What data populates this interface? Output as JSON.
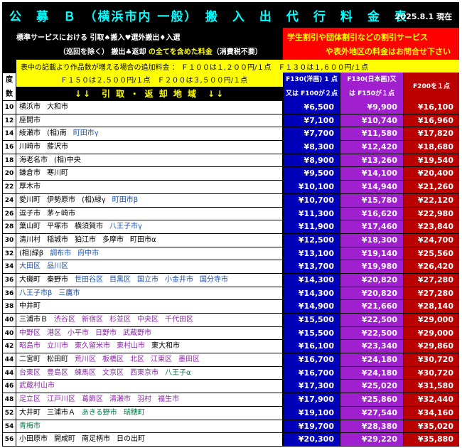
{
  "header": {
    "title": "公　募　Ｂ　（横浜市内 一般）　搬　入　出　代　行　料　金　表",
    "date": "2025.8.1 現在"
  },
  "service_left": {
    "line1_a": "標準サービスにおける ",
    "line1_b": "引取♠搬入♥選外搬出♦入選",
    "line2_a": "（巡回を除く） ",
    "line2_b": "搬出♣返却",
    "line2_c": " の全てを含めた料金",
    "line2_d": "（消費税不要）"
  },
  "service_right": {
    "line1": "学生割引や団体割引などの割引サービス",
    "line2": "や表外地区の料金はお問合せ下さい"
  },
  "note": {
    "line1": "表中の記載より作品数が増える場合の追加料金 ： Ｆ１００は１,２００円/１点　Ｆ１３０は１,６００円/１点",
    "line2": "Ｆ１５０は２,５００円/１点　Ｆ２００は３,５００円/１点"
  },
  "table_header": {
    "do_top": "度",
    "do_bottom": "数",
    "area": "↓↓　引 取 ・ 返 却 地 域　↓↓",
    "col1_top": "F130(洋画) 1 点",
    "col1_bottom": "又は F100が２点",
    "col2_top": "F130(日本画)又",
    "col2_bottom": "は F150が１点",
    "col3": "F200を１点"
  },
  "rows": [
    {
      "code": "10",
      "areas": [
        {
          "t": "横浜市",
          "c": "k"
        },
        {
          "t": "大和市",
          "c": "k"
        }
      ],
      "p1": "¥6,500",
      "p2": "¥9,900",
      "p3": "¥16,100"
    },
    {
      "code": "12",
      "areas": [
        {
          "t": "座間市",
          "c": "k"
        }
      ],
      "p1": "¥7,100",
      "p2": "¥10,740",
      "p3": "¥16,960"
    },
    {
      "code": "14",
      "areas": [
        {
          "t": "綾瀬市",
          "c": "k"
        },
        {
          "t": "(相)南",
          "c": "k"
        },
        {
          "t": "町田市γ",
          "c": "h"
        }
      ],
      "p1": "¥7,700",
      "p2": "¥11,580",
      "p3": "¥17,820"
    },
    {
      "code": "16",
      "areas": [
        {
          "t": "川崎市",
          "c": "k"
        },
        {
          "t": "藤沢市",
          "c": "k"
        }
      ],
      "p1": "¥8,300",
      "p2": "¥12,420",
      "p3": "¥18,680"
    },
    {
      "code": "18",
      "areas": [
        {
          "t": "海老名市",
          "c": "k"
        },
        {
          "t": "(相)中央",
          "c": "k"
        }
      ],
      "p1": "¥8,900",
      "p2": "¥13,260",
      "p3": "¥19,540"
    },
    {
      "code": "20",
      "areas": [
        {
          "t": "鎌倉市",
          "c": "k"
        },
        {
          "t": "寒川町",
          "c": "k"
        }
      ],
      "p1": "¥9,500",
      "p2": "¥14,100",
      "p3": "¥20,400"
    },
    {
      "code": "22",
      "areas": [
        {
          "t": "厚木市",
          "c": "k"
        }
      ],
      "p1": "¥10,100",
      "p2": "¥14,940",
      "p3": "¥21,260"
    },
    {
      "code": "24",
      "areas": [
        {
          "t": "愛川町",
          "c": "k"
        },
        {
          "t": "伊勢原市",
          "c": "k"
        },
        {
          "t": "(相)緑γ",
          "c": "k"
        },
        {
          "t": "町田市β",
          "c": "h"
        }
      ],
      "p1": "¥10,700",
      "p2": "¥15,780",
      "p3": "¥22,120"
    },
    {
      "code": "26",
      "areas": [
        {
          "t": "逗子市",
          "c": "k"
        },
        {
          "t": "茅ヶ崎市",
          "c": "k"
        }
      ],
      "p1": "¥11,300",
      "p2": "¥16,620",
      "p3": "¥22,980"
    },
    {
      "code": "28",
      "areas": [
        {
          "t": "葉山町",
          "c": "k"
        },
        {
          "t": "平塚市",
          "c": "k"
        },
        {
          "t": "横須賀市",
          "c": "k"
        },
        {
          "t": "八王子市γ",
          "c": "h"
        }
      ],
      "p1": "¥11,900",
      "p2": "¥17,460",
      "p3": "¥23,840"
    },
    {
      "code": "30",
      "areas": [
        {
          "t": "清川村",
          "c": "k"
        },
        {
          "t": "稲城市",
          "c": "k"
        },
        {
          "t": "狛江市",
          "c": "k"
        },
        {
          "t": "多摩市",
          "c": "k"
        },
        {
          "t": "町田市α",
          "c": "k"
        }
      ],
      "p1": "¥12,500",
      "p2": "¥18,300",
      "p3": "¥24,700"
    },
    {
      "code": "32",
      "areas": [
        {
          "t": "(相)緑β",
          "c": "k"
        },
        {
          "t": "調布市",
          "c": "h"
        },
        {
          "t": "府中市",
          "c": "h"
        }
      ],
      "p1": "¥13,100",
      "p2": "¥19,140",
      "p3": "¥25,560"
    },
    {
      "code": "34",
      "areas": [
        {
          "t": "大田区",
          "c": "h"
        },
        {
          "t": "品川区",
          "c": "h"
        }
      ],
      "p1": "¥13,700",
      "p2": "¥19,980",
      "p3": "¥26,420"
    },
    {
      "code": "36",
      "areas": [
        {
          "t": "大磯町",
          "c": "k"
        },
        {
          "t": "秦野市",
          "c": "k"
        },
        {
          "t": "世田谷区",
          "c": "h"
        },
        {
          "t": "目黒区",
          "c": "h"
        },
        {
          "t": "国立市",
          "c": "h"
        },
        {
          "t": "小金井市",
          "c": "h"
        },
        {
          "t": "国分寺市",
          "c": "h"
        }
      ],
      "p1": "¥14,300",
      "p2": "¥20,820",
      "p3": "¥27,280"
    },
    {
      "code": "36",
      "areas": [
        {
          "t": "八王子市β",
          "c": "h"
        },
        {
          "t": "三鷹市",
          "c": "h"
        }
      ],
      "p1": "¥14,300",
      "p2": "¥20,820",
      "p3": "¥27,280"
    },
    {
      "code": "38",
      "areas": [
        {
          "t": "中井町",
          "c": "k"
        }
      ],
      "p1": "¥14,900",
      "p2": "¥21,660",
      "p3": "¥28,140"
    },
    {
      "code": "40",
      "areas": [
        {
          "t": "三浦市Ｂ",
          "c": "k"
        },
        {
          "t": "渋谷区",
          "c": "m"
        },
        {
          "t": "新宿区",
          "c": "m"
        },
        {
          "t": "杉並区",
          "c": "m"
        },
        {
          "t": "中央区",
          "c": "m"
        },
        {
          "t": "千代田区",
          "c": "m"
        }
      ],
      "p1": "¥15,500",
      "p2": "¥22,500",
      "p3": "¥29,000"
    },
    {
      "code": "40",
      "areas": [
        {
          "t": "中野区",
          "c": "m"
        },
        {
          "t": "港区",
          "c": "m"
        },
        {
          "t": "小平市",
          "c": "m"
        },
        {
          "t": "日野市",
          "c": "m"
        },
        {
          "t": "武蔵野市",
          "c": "m"
        }
      ],
      "p1": "¥15,500",
      "p2": "¥22,500",
      "p3": "¥29,000"
    },
    {
      "code": "42",
      "areas": [
        {
          "t": "昭島市",
          "c": "m"
        },
        {
          "t": "立川市",
          "c": "m"
        },
        {
          "t": "東久留米市",
          "c": "m"
        },
        {
          "t": "東村山市",
          "c": "m"
        },
        {
          "t": "東大和市",
          "c": "b"
        }
      ],
      "p1": "¥16,100",
      "p2": "¥23,340",
      "p3": "¥29,860"
    },
    {
      "code": "44",
      "areas": [
        {
          "t": "二宮町",
          "c": "k"
        },
        {
          "t": "松田町",
          "c": "k"
        },
        {
          "t": "荒川区",
          "c": "m"
        },
        {
          "t": "板橋区",
          "c": "m"
        },
        {
          "t": "北区",
          "c": "m"
        },
        {
          "t": "江東区",
          "c": "m"
        },
        {
          "t": "墨田区",
          "c": "m"
        }
      ],
      "p1": "¥16,700",
      "p2": "¥24,180",
      "p3": "¥30,720"
    },
    {
      "code": "44",
      "areas": [
        {
          "t": "台東区",
          "c": "m"
        },
        {
          "t": "豊島区",
          "c": "m"
        },
        {
          "t": "練馬区",
          "c": "m"
        },
        {
          "t": "文京区",
          "c": "m"
        },
        {
          "t": "西東京市",
          "c": "m"
        },
        {
          "t": "八王子α",
          "c": "g"
        }
      ],
      "p1": "¥16,700",
      "p2": "¥24,180",
      "p3": "¥30,720"
    },
    {
      "code": "46",
      "areas": [
        {
          "t": "武蔵村山市",
          "c": "m"
        }
      ],
      "p1": "¥17,300",
      "p2": "¥25,020",
      "p3": "¥31,580"
    },
    {
      "code": "48",
      "areas": [
        {
          "t": "足立区",
          "c": "m"
        },
        {
          "t": "江戸川区",
          "c": "m"
        },
        {
          "t": "葛飾区",
          "c": "m"
        },
        {
          "t": "清瀬市",
          "c": "m"
        },
        {
          "t": "羽村",
          "c": "m"
        },
        {
          "t": "福生市",
          "c": "m"
        }
      ],
      "p1": "¥17,900",
      "p2": "¥25,860",
      "p3": "¥32,440"
    },
    {
      "code": "52",
      "areas": [
        {
          "t": "大井町",
          "c": "k"
        },
        {
          "t": "三浦市Ａ",
          "c": "k"
        },
        {
          "t": "あきる野市",
          "c": "g"
        },
        {
          "t": "瑞穂町",
          "c": "g"
        }
      ],
      "p1": "¥19,100",
      "p2": "¥27,540",
      "p3": "¥34,160"
    },
    {
      "code": "54",
      "areas": [
        {
          "t": "青梅市",
          "c": "g"
        }
      ],
      "p1": "¥19,700",
      "p2": "¥28,380",
      "p3": "¥35,020"
    },
    {
      "code": "56",
      "areas": [
        {
          "t": "小田原市",
          "c": "k"
        },
        {
          "t": "開成町",
          "c": "k"
        },
        {
          "t": "南足柄市",
          "c": "k"
        },
        {
          "t": "日の出町",
          "c": "k"
        }
      ],
      "p1": "¥20,300",
      "p2": "¥29,220",
      "p3": "¥35,880"
    }
  ]
}
